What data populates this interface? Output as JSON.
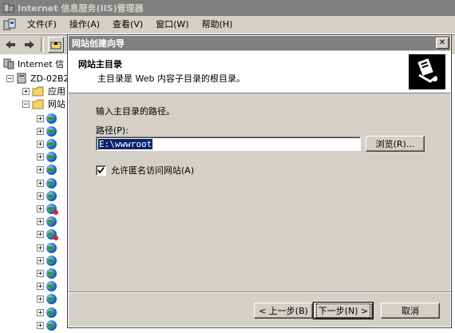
{
  "window": {
    "title": "Internet 信息服务(IIS)管理器"
  },
  "menu": {
    "items": [
      "文件(F)",
      "操作(A)",
      "查看(V)",
      "窗口(W)",
      "帮助(H)"
    ]
  },
  "tree": {
    "root_label": "Internet 信",
    "server_label": "ZD-02B2",
    "app_pools_label": "应用",
    "websites_label": "网站",
    "site_count": 18,
    "stopped_site_rows": [
      7,
      9
    ]
  },
  "wizard": {
    "title": "网站创建向导",
    "close_label": "✕",
    "header_title": "网站主目录",
    "header_subtitle": "主目录是 Web 内容子目录的根目录。",
    "instruction": "输入主目录的路径。",
    "path_label": "路径(P):",
    "path_value": "E:\\wwwroot",
    "browse_button": "浏览(R)...",
    "anonymous_label": "允许匿名访问网站(A)",
    "anonymous_checked": true,
    "back_button": "< 上一步(B)",
    "next_button": "下一步(N) >",
    "cancel_button": "取消"
  },
  "colors": {
    "dialog_bg": "#d4d0c8",
    "title_inactive": "#808080",
    "selection": "#0a246a"
  }
}
